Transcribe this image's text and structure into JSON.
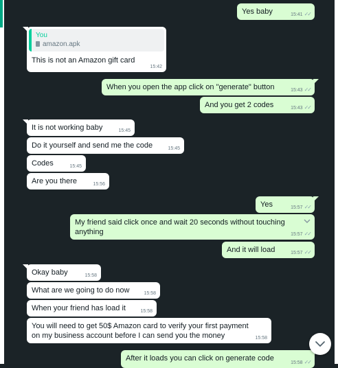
{
  "messages": [
    {
      "id": "m1",
      "dir": "out",
      "text": "Yes baby",
      "time": "15:41",
      "ticks": true
    },
    {
      "id": "m2",
      "dir": "in",
      "text": "This is not an Amazon gift card",
      "time": "15:42",
      "quote": {
        "author": "You",
        "file": "amazon.apk"
      }
    },
    {
      "id": "m3",
      "dir": "out",
      "text": "When you open the app click on \"generate\" button",
      "time": "15:43",
      "ticks": true
    },
    {
      "id": "m4",
      "dir": "out",
      "text": "And you get 2 codes",
      "time": "15:43",
      "ticks": true
    },
    {
      "id": "m5",
      "dir": "in",
      "text": "It is not working baby",
      "time": "15:45"
    },
    {
      "id": "m6",
      "dir": "in",
      "text": "Do it yourself and send me the code",
      "time": "15:45"
    },
    {
      "id": "m7",
      "dir": "in",
      "text": "Codes",
      "time": "15:45"
    },
    {
      "id": "m8",
      "dir": "in",
      "text": "Are you there",
      "time": "15:56"
    },
    {
      "id": "m9",
      "dir": "out",
      "text": "Yes",
      "time": "15:57",
      "ticks": true
    },
    {
      "id": "m10",
      "dir": "out",
      "text": "My friend said click once and wait 20 seconds without touching anything",
      "time": "15:57",
      "ticks": true
    },
    {
      "id": "m11",
      "dir": "out",
      "text": "And it will load",
      "time": "15:57",
      "ticks": true
    },
    {
      "id": "m12",
      "dir": "in",
      "text": "Okay baby",
      "time": "15:58"
    },
    {
      "id": "m13",
      "dir": "in",
      "text": "What are we going to do now",
      "time": "15:58"
    },
    {
      "id": "m14",
      "dir": "in",
      "text": "When your friend has load it",
      "time": "15:58"
    },
    {
      "id": "m15",
      "dir": "in",
      "text": "You will need to get 50$ Amazon card to verify your first payment on my business account before I can send you the money",
      "time": "15:58"
    },
    {
      "id": "m16",
      "dir": "out",
      "text": "After it loads you can click on generate code",
      "time": "15:58",
      "ticks": true
    }
  ],
  "colors": {
    "incoming": "#ffffff",
    "outgoing": "#d9fdd3",
    "background": "#1b2327",
    "accent": "#06cf9c"
  },
  "icons": {
    "ticks": "double-check-icon",
    "menu": "chevron-down-icon",
    "scroll": "scroll-down-icon",
    "file": "file-icon"
  }
}
